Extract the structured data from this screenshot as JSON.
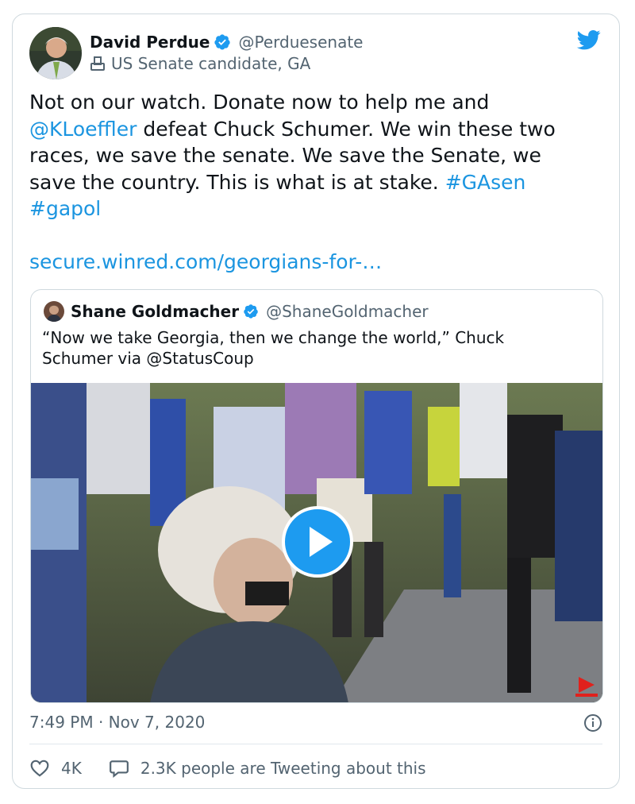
{
  "author": {
    "name": "David Perdue",
    "handle": "@Perduesenate",
    "label": "US Senate candidate, GA"
  },
  "icons": {
    "verified": "verified-badge-icon",
    "label": "ballot-box-icon",
    "brand": "twitter-bird-icon",
    "play": "play-icon",
    "info": "info-icon",
    "like": "heart-icon",
    "reply": "speech-bubble-icon"
  },
  "colors": {
    "link": "#1b95e0",
    "verified": "#1d9bf0",
    "muted": "#536471",
    "text": "#0f1419",
    "border": "#cfd9de"
  },
  "tweet": {
    "line1": "Not on our watch. Donate now to help me and",
    "mention": "@KLoeffler",
    "line2_rest": " defeat Chuck Schumer. We win these two",
    "line3": "races, we save the senate. We save the Senate, we",
    "line4": "save the country. This is what is at stake. ",
    "hashtag1": "#GAsen",
    "hashtag2": "#gapol",
    "url": "secure.winred.com/georgians-for-…"
  },
  "quoted": {
    "name": "Shane Goldmacher",
    "handle": "@ShaneGoldmacher",
    "line1": "“Now we take Georgia, then we change the world,” Chuck",
    "line2": "Schumer via @StatusCoup"
  },
  "footer": {
    "timestamp": "7:49 PM · Nov 7, 2020",
    "likes": "4K",
    "conversation": "2.3K people are Tweeting about this"
  }
}
